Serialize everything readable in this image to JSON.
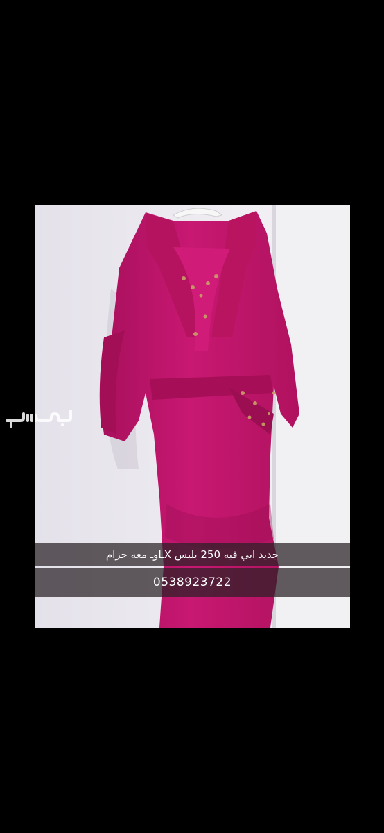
{
  "watermark": {
    "brand": "مستعمل"
  },
  "listing": {
    "caption_line1": "جديد ابي فيه 250 يلبس LXوـ معه حزام",
    "caption_line2": "0538923722",
    "dress_color": "#c41770"
  }
}
